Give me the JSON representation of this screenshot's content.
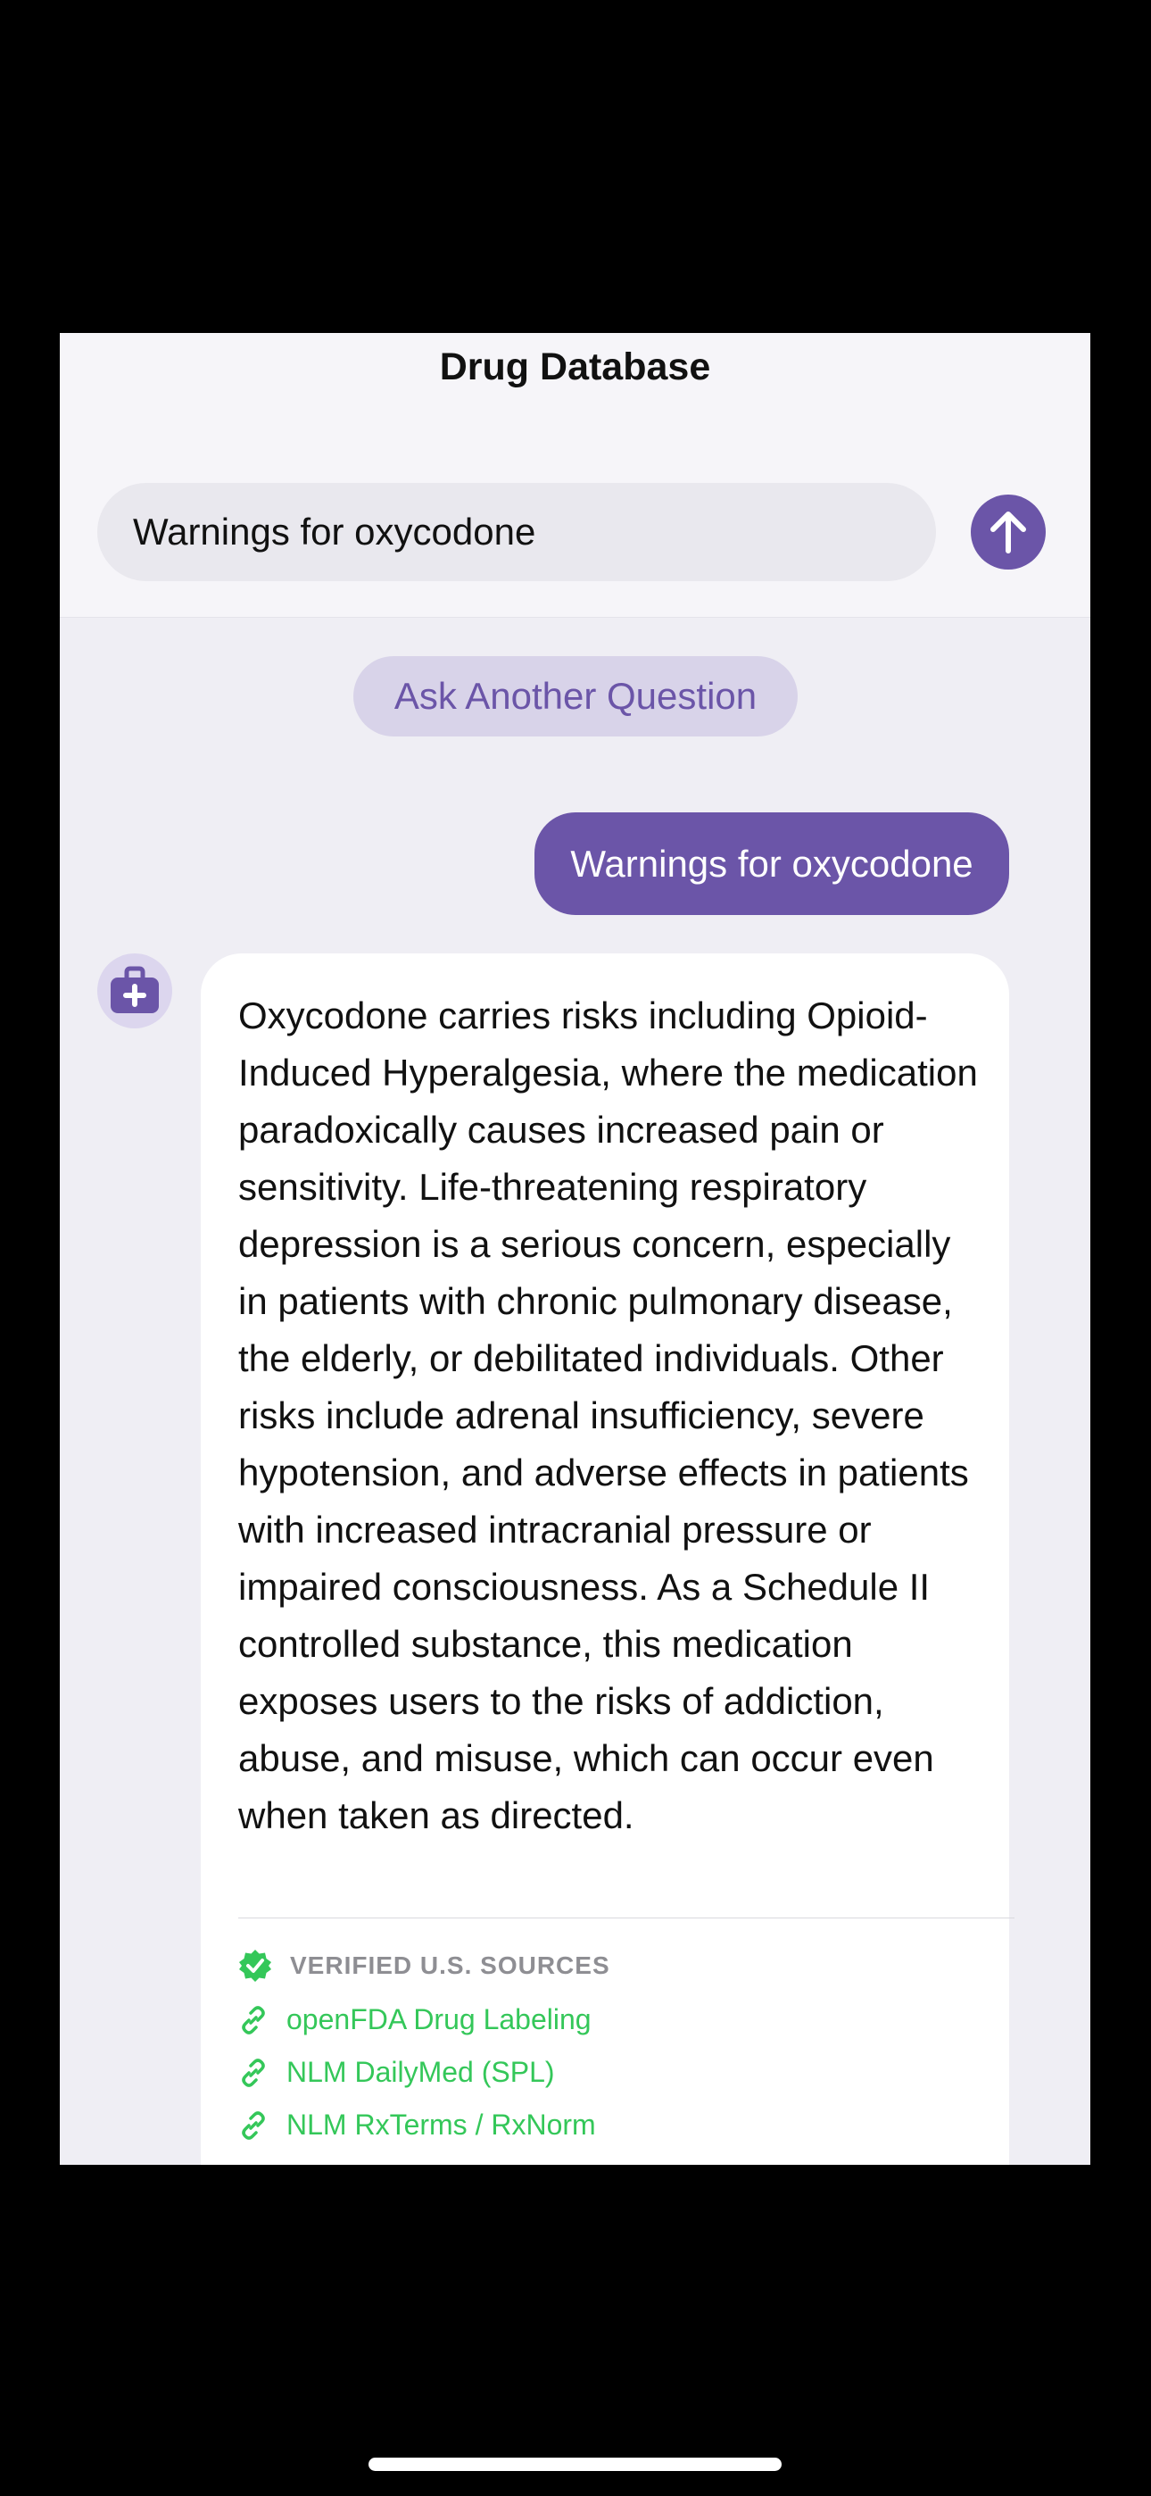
{
  "nav": {
    "title": "Drug Database"
  },
  "search": {
    "value": "Warnings for oxycodone"
  },
  "actions": {
    "ask_another": "Ask Another Question"
  },
  "messages": {
    "user": "Warnings for oxycodone",
    "assistant": "Oxycodone carries risks including Opioid-Induced Hyperalgesia, where the medication paradoxically causes increased pain or sensitivity. Life-threatening respiratory depression is a serious concern, especially in patients with chronic pulmonary disease, the elderly, or debilitated individuals. Other risks include adrenal insufficiency, severe hypotension, and adverse effects in patients with increased intracranial pressure or impaired consciousness. As a Schedule II controlled substance, this medication exposes users to the risks of addiction, abuse, and misuse, which can occur even when taken as directed."
  },
  "sources": {
    "heading": "VERIFIED U.S. SOURCES",
    "items": [
      {
        "label": "openFDA Drug Labeling"
      },
      {
        "label": "NLM DailyMed (SPL)"
      },
      {
        "label": "NLM RxTerms / RxNorm"
      }
    ]
  },
  "icons": {
    "send": "arrow-up-icon",
    "avatar": "medical-kit-icon",
    "verified": "verified-check-icon",
    "link": "link-icon"
  },
  "colors": {
    "accent": "#6b55a8",
    "accent_soft": "#d8d3e9",
    "success": "#34c759",
    "background": "#efeef4"
  }
}
